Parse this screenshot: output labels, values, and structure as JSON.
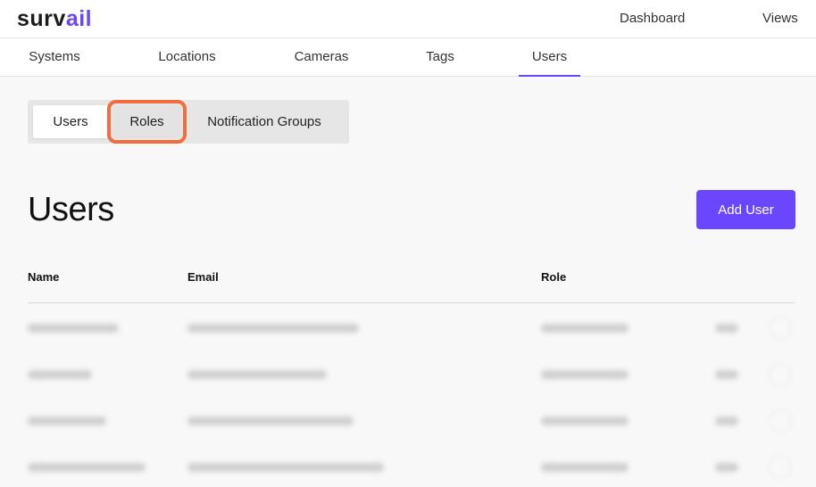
{
  "header": {
    "logo_main": "surv",
    "logo_accent": "ail",
    "links": [
      "Dashboard",
      "Views"
    ]
  },
  "nav": {
    "tabs": [
      "Systems",
      "Locations",
      "Cameras",
      "Tags",
      "Users"
    ],
    "active": "Users"
  },
  "subtabs": {
    "items": [
      "Users",
      "Roles",
      "Notification Groups"
    ],
    "active": "Users",
    "highlighted": "Roles"
  },
  "page": {
    "title": "Users",
    "add_button": "Add User"
  },
  "table": {
    "columns": [
      "Name",
      "Email",
      "Role"
    ],
    "rows_note_count": 4
  },
  "colors": {
    "accent": "#6b46ff",
    "highlight": "#f26d3d"
  }
}
